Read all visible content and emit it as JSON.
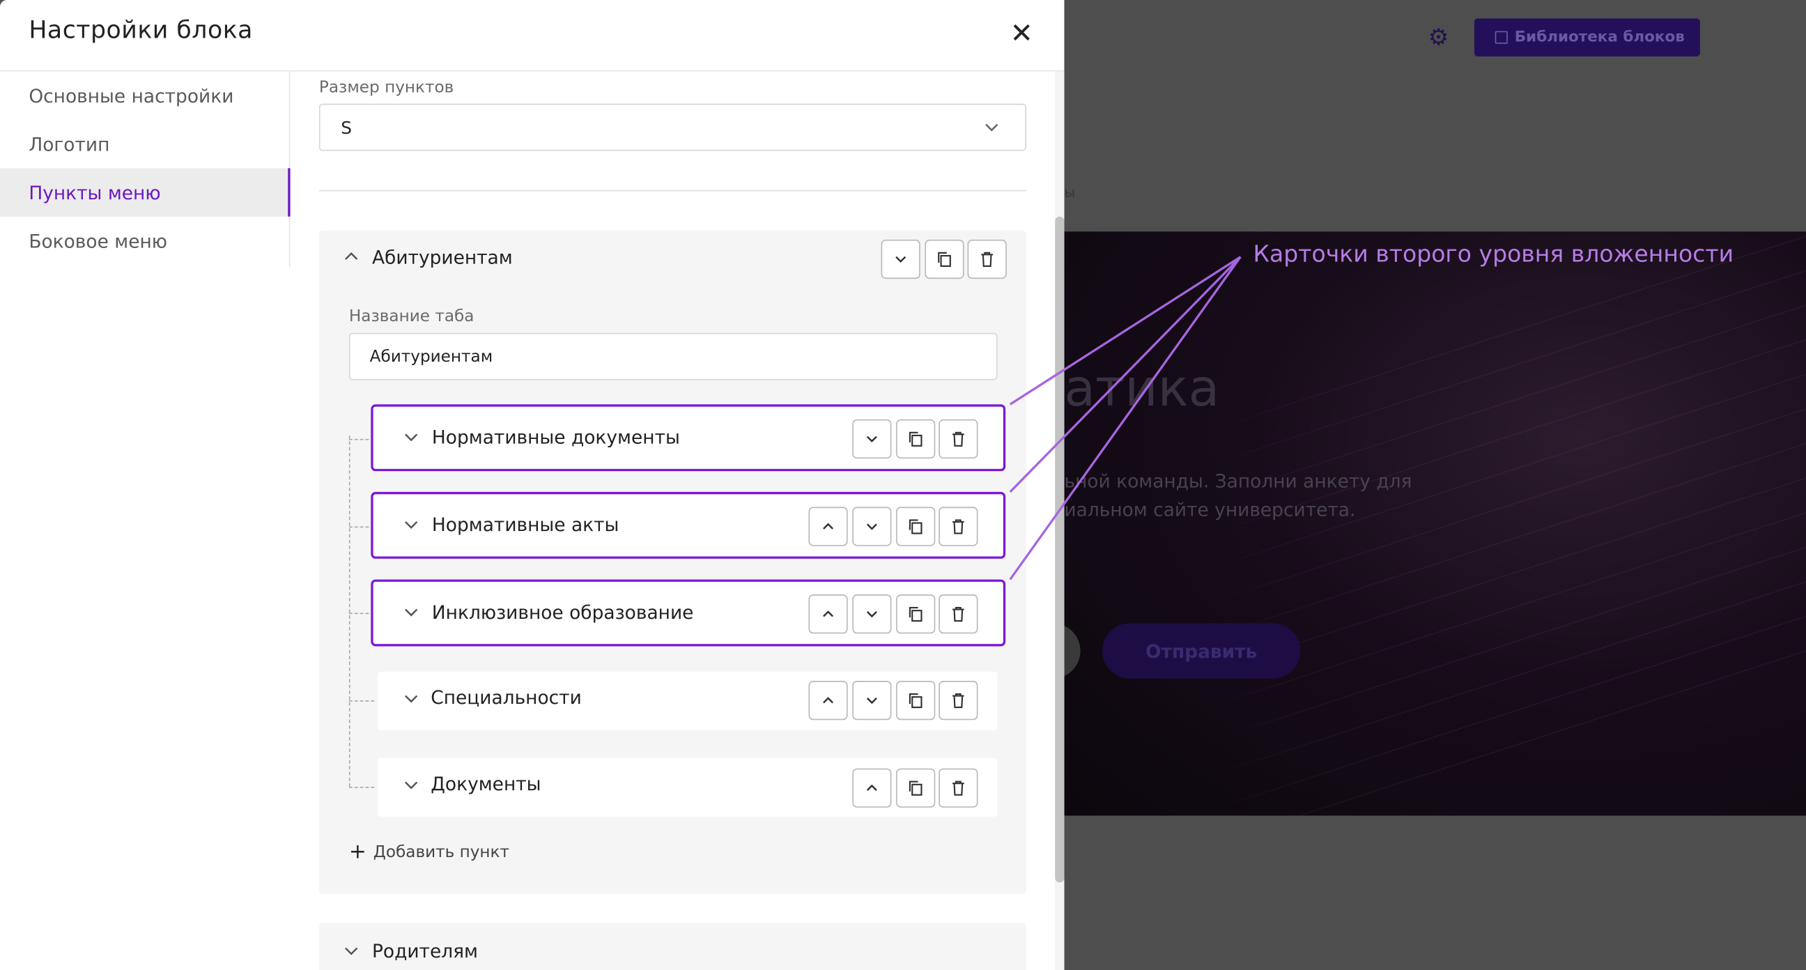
{
  "modal": {
    "title": "Настройки блока",
    "close_icon": "close-icon"
  },
  "sidebar": {
    "items": [
      {
        "label": "Основные настройки",
        "active": false
      },
      {
        "label": "Логотип",
        "active": false
      },
      {
        "label": "Пункты меню",
        "active": true
      },
      {
        "label": "Боковое меню",
        "active": false
      }
    ]
  },
  "content": {
    "size_label": "Размер пунктов",
    "size_value": "S",
    "group": {
      "title": "Абитуриентам",
      "tab_name_label": "Название таба",
      "tab_name_value": "Абитуриентам",
      "items": [
        {
          "title": "Нормативные документы",
          "buttons": [
            "down",
            "copy",
            "delete"
          ]
        },
        {
          "title": "Нормативные акты",
          "buttons": [
            "up",
            "down",
            "copy",
            "delete"
          ]
        },
        {
          "title": "Инклюзивное образование",
          "buttons": [
            "up",
            "down",
            "copy",
            "delete"
          ]
        },
        {
          "title": "Специальности",
          "buttons": [
            "up",
            "down",
            "copy",
            "delete"
          ]
        },
        {
          "title": "Документы",
          "buttons": [
            "up",
            "copy",
            "delete"
          ]
        }
      ],
      "add_item_label": "Добавить пункт"
    },
    "group2": {
      "title": "Родителям"
    }
  },
  "background": {
    "library_button": "Библиотека блоков",
    "heading_fragment": "атика",
    "text_line1": "ьной команды. Заполни анкету для",
    "text_line2": "иальном сайте университета.",
    "submit_label": "Отправить",
    "side_fragment": "ы"
  },
  "annotation": {
    "label": "Карточки второго уровня вложенности",
    "color": "#b67de6"
  },
  "colors": {
    "accent": "#6b18c4",
    "highlight_border": "#7b18d8"
  }
}
